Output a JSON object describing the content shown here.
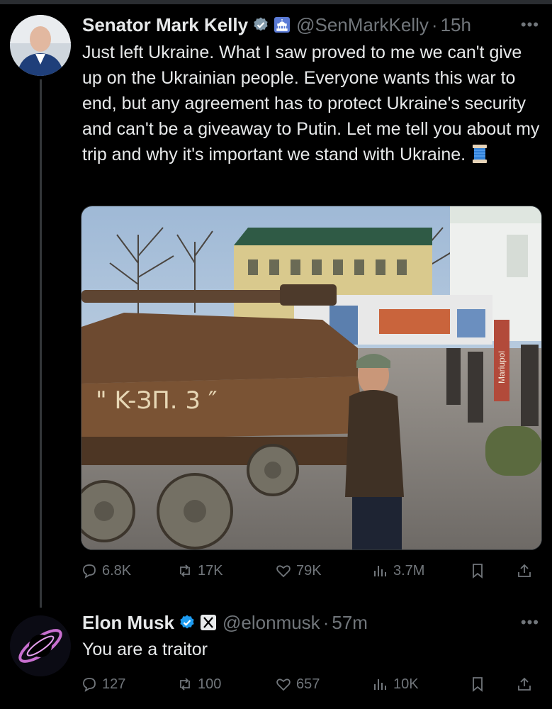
{
  "tweet1": {
    "author_name": "Senator Mark Kelly",
    "handle": "@SenMarkKelly",
    "time": "15h",
    "text": "Just left Ukraine. What I saw proved to me we can't give up on the Ukrainian people. Everyone wants this war to end, but any agreement has to protect Ukraine's security and can't be a giveaway to Putin. Let me tell you about my trip and why it's important we stand with Ukraine.",
    "emoji_icon": "thread-spool-icon",
    "image_sign": "Mariupol",
    "stats": {
      "replies": "6.8K",
      "reposts": "17K",
      "likes": "79K",
      "views": "3.7M"
    }
  },
  "tweet2": {
    "author_name": "Elon Musk",
    "handle": "@elonmusk",
    "time": "57m",
    "text": "You are a traitor",
    "stats": {
      "replies": "127",
      "reposts": "100",
      "likes": "657",
      "views": "10K"
    }
  },
  "separator": "·",
  "colors": {
    "background": "#000000",
    "text": "#e7e9ea",
    "secondary": "#71767b",
    "verified_blue": "#1d9bf0",
    "gov_badge": "#829aab"
  }
}
